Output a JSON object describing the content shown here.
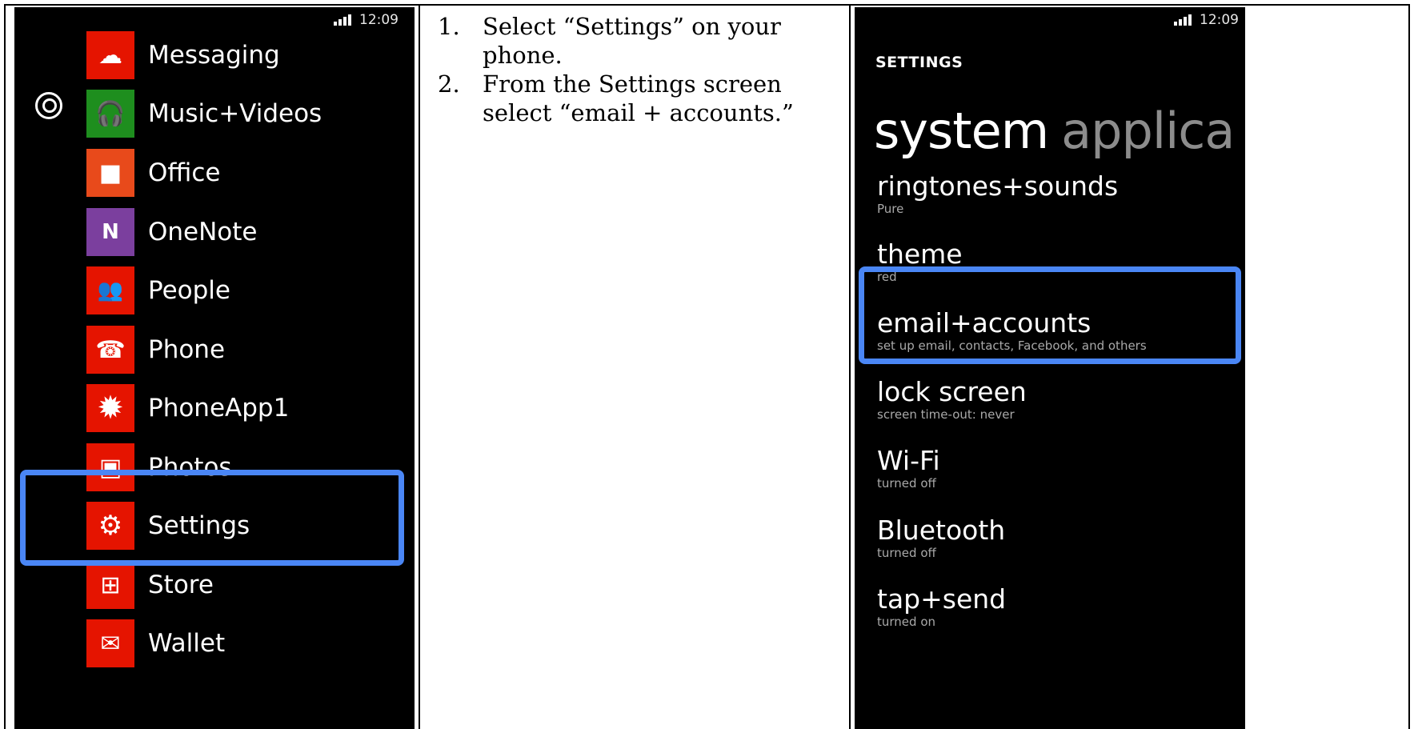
{
  "left_phone": {
    "time": "12:09",
    "apps": [
      {
        "label": "Messaging",
        "color": "#e51400",
        "icon": "☁"
      },
      {
        "label": "Music+Videos",
        "color": "#1e8e1e",
        "icon": "🎧"
      },
      {
        "label": "Office",
        "color": "#e84a1b",
        "icon": "■"
      },
      {
        "label": "OneNote",
        "color": "#7b3f9e",
        "icon": "N"
      },
      {
        "label": "People",
        "color": "#e51400",
        "icon": "👥"
      },
      {
        "label": "Phone",
        "color": "#e51400",
        "icon": "☎"
      },
      {
        "label": "PhoneApp1",
        "color": "#e51400",
        "icon": "✹"
      },
      {
        "label": "Photos",
        "color": "#e51400",
        "icon": "▣"
      },
      {
        "label": "Settings",
        "color": "#e51400",
        "icon": "⚙"
      },
      {
        "label": "Store",
        "color": "#e51400",
        "icon": "⊞"
      },
      {
        "label": "Wallet",
        "color": "#e51400",
        "icon": "✉"
      }
    ]
  },
  "instructions": {
    "steps": [
      {
        "num": "1.",
        "text": "Select “Settings” on your phone."
      },
      {
        "num": "2.",
        "text": "From the Settings screen select “email + accounts.”"
      }
    ]
  },
  "right_phone": {
    "time": "12:09",
    "header": "SETTINGS",
    "pivot_active": "system",
    "pivot_inactive": "applica",
    "items": [
      {
        "title": "ringtones+sounds",
        "subtitle": "Pure"
      },
      {
        "title": "theme",
        "subtitle": "red"
      },
      {
        "title": "email+accounts",
        "subtitle": "set up email, contacts, Facebook, and others"
      },
      {
        "title": "lock screen",
        "subtitle": "screen time-out: never"
      },
      {
        "title": "Wi-Fi",
        "subtitle": "turned off"
      },
      {
        "title": "Bluetooth",
        "subtitle": "turned off"
      },
      {
        "title": "tap+send",
        "subtitle": "turned on"
      }
    ]
  },
  "colors": {
    "highlight": "#4a86f5",
    "accent_red": "#e51400"
  }
}
